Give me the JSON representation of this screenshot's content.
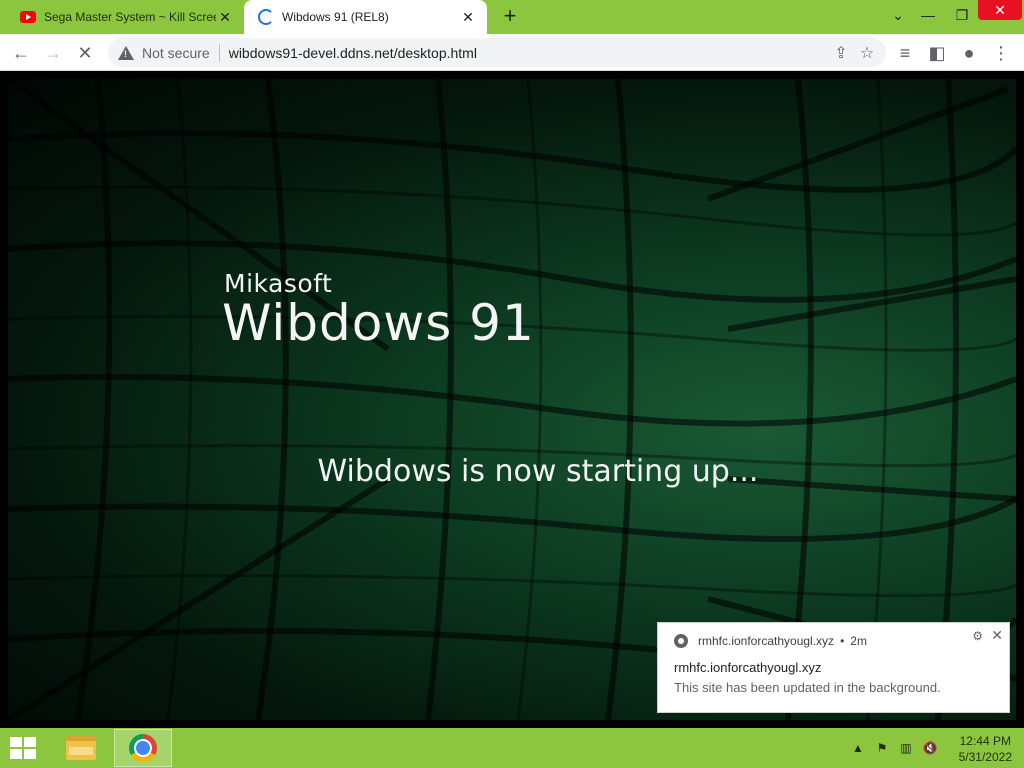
{
  "browser": {
    "tabs": [
      {
        "title": "Sega Master System ~ Kill Screen",
        "favicon": "youtube-icon"
      },
      {
        "title": "Wibdows 91 (REL8)",
        "favicon": "loading-spinner-icon"
      }
    ],
    "new_tab_label": "+",
    "address": {
      "security_label": "Not secure",
      "url": "wibdows91-devel.ddns.net/desktop.html"
    },
    "accent_color": "#8cc63f"
  },
  "page": {
    "brand_small": "Mikasoft",
    "brand_big": "Wibdows 91",
    "status_text": "Wibdows is now starting up..."
  },
  "notification": {
    "source": "rmhfc.ionforcathyougl.xyz",
    "separator": "•",
    "age": "2m",
    "title": "rmhfc.ionforcathyougl.xyz",
    "body": "This site has been updated in the background."
  },
  "taskbar": {
    "time": "12:44 PM",
    "date": "5/31/2022",
    "apps": [
      "file-explorer-icon",
      "chrome-icon"
    ]
  }
}
